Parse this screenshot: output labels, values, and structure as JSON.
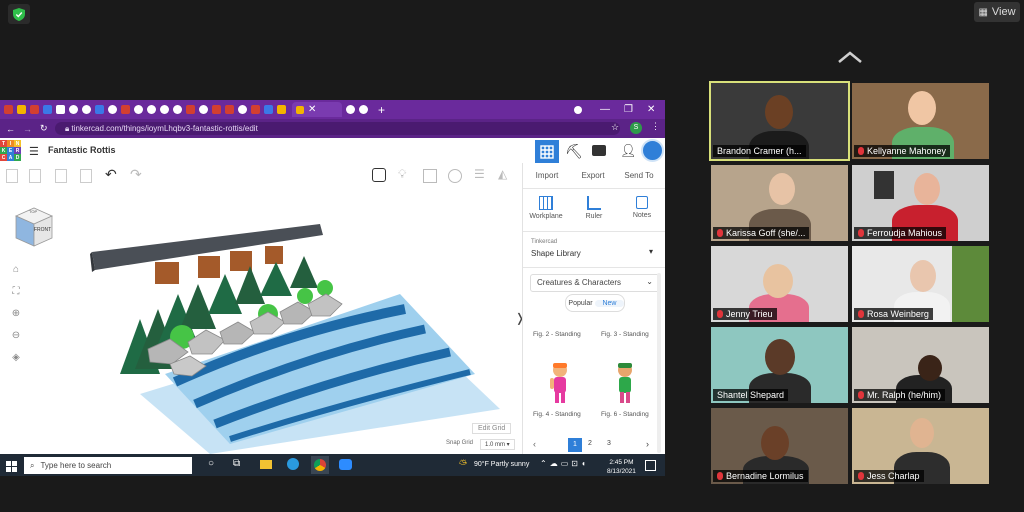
{
  "zoom": {
    "view_label": "View",
    "participants": [
      {
        "name": "Brandon Cramer (h...",
        "muted": false,
        "active": true
      },
      {
        "name": "Kellyanne Mahoney",
        "muted": true
      },
      {
        "name": "Karissa Goff (she/...",
        "muted": true
      },
      {
        "name": "Ferroudja Mahious",
        "muted": true
      },
      {
        "name": "Jenny Trieu",
        "muted": true
      },
      {
        "name": "Rosa Weinberg",
        "muted": true
      },
      {
        "name": "Shantel Shepard",
        "muted": false
      },
      {
        "name": "Mr. Ralph (he/him)",
        "muted": true
      },
      {
        "name": "Bernadine Lormilus",
        "muted": true
      },
      {
        "name": "Jess Charlap",
        "muted": true
      }
    ]
  },
  "browser": {
    "url": "tinkercad.com/things/ioymLhqbv3-fantastic-rottis/edit",
    "profile_initial": "S"
  },
  "tinkercad": {
    "logo_letters": [
      "T",
      "I",
      "N",
      "K",
      "E",
      "R",
      "C",
      "A",
      "D"
    ],
    "project_title": "Fantastic Rottis",
    "actions": {
      "import": "Import",
      "export": "Export",
      "send_to": "Send To"
    },
    "tools": {
      "workplane": "Workplane",
      "ruler": "Ruler",
      "notes": "Notes"
    },
    "view_cube": {
      "top": "TOP",
      "front": "FRONT"
    },
    "library": {
      "source": "Tinkercad",
      "name": "Shape Library",
      "category": "Creatures & Characters",
      "tabs": {
        "popular": "Popular",
        "new": "New"
      },
      "shapes": [
        "Fig. 2 - Standing",
        "Fig. 3 - Standing",
        "Fig. 4 - Standing",
        "Fig. 6 - Standing"
      ],
      "pages": [
        "1",
        "2",
        "3"
      ],
      "current_page": "1"
    },
    "edit_grid": "Edit Grid",
    "snap_grid_label": "Snap Grid",
    "snap_grid_value": "1.0 mm"
  },
  "windows_taskbar": {
    "search_placeholder": "Type here to search",
    "weather": "90°F  Partly sunny",
    "time": "2:45 PM",
    "date": "8/13/2021"
  },
  "colors": {
    "browser_tab_bar": "#6a2a9c",
    "tinkercad_blue": "#2f7fd8",
    "active_speaker_border": "#d8e07a",
    "muted_mic": "#e0353b",
    "water_dark": "#1e6aa8",
    "water_light": "#9fd0ee"
  }
}
